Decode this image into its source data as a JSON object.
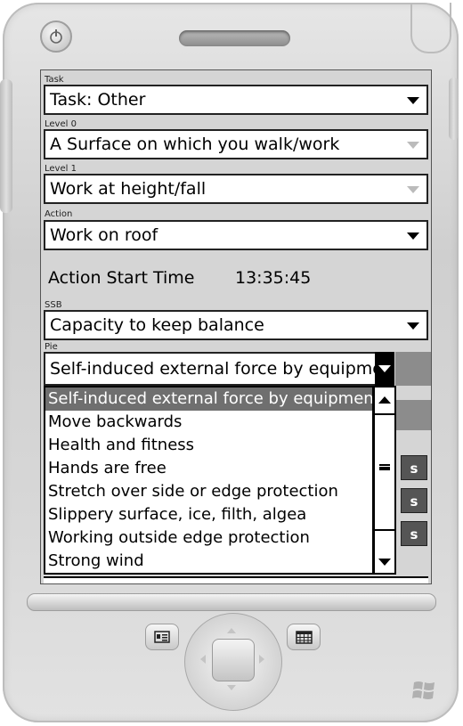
{
  "form": {
    "task": {
      "label": "Task",
      "value": "Task: Other"
    },
    "level0": {
      "label": "Level 0",
      "value": "A Surface on which you walk/work"
    },
    "level1": {
      "label": "Level 1",
      "value": "Work at height/fall"
    },
    "action": {
      "label": "Action",
      "value": "Work on roof"
    },
    "action_start_time": {
      "label": "Action Start Time",
      "value": "13:35:45"
    },
    "ssb": {
      "label": "SSB",
      "value": "Capacity to keep balance"
    },
    "pie": {
      "label": "Pie",
      "value": "Self-induced external force by equipment",
      "options": [
        "Self-induced external force by equipment",
        "Move backwards",
        "Health and fitness",
        "Hands are free",
        "Stretch over side or edge protection",
        "Slippery surface, ice, filth, algea",
        "Working outside edge protection",
        "Strong wind"
      ],
      "selected_index": 0
    },
    "side_buttons": [
      "s",
      "s",
      "s"
    ]
  },
  "colors": {
    "screen_bg": "#d5d5d5",
    "selection_bg": "#6f6f6f",
    "side_button_bg": "#555555"
  },
  "icons": {
    "power": "power-icon",
    "contacts": "contact-card-icon",
    "calendar": "calendar-grid-icon",
    "windows": "windows-logo-icon"
  }
}
